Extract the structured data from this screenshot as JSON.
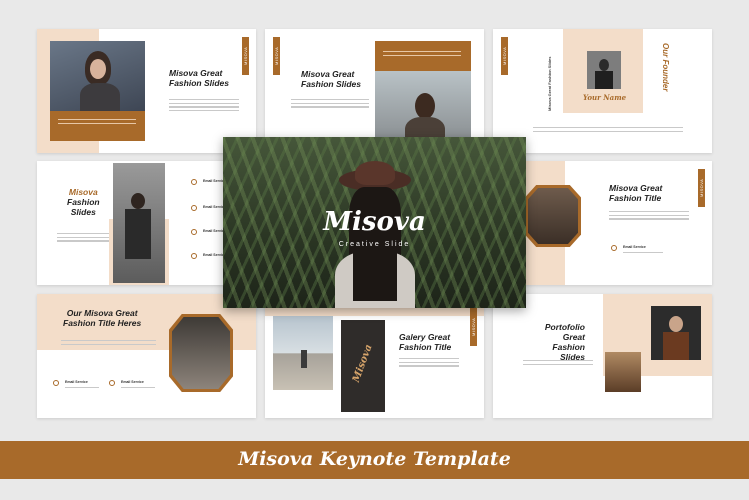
{
  "hero": {
    "logo": "Misova",
    "subtitle": "Creative Slide"
  },
  "slides": {
    "s1": {
      "title_1": "Misova Great",
      "title_2": "Fashion Slides",
      "tab": "MISOVA"
    },
    "s2": {
      "title_1": "Misova Great",
      "title_2": "Fashion Slides",
      "tab": "MISOVA"
    },
    "s3": {
      "side_text": "Misova Great Fashion Slides",
      "name": "Your Name",
      "founder": "Our Founder",
      "tab": "MISOVA"
    },
    "s4": {
      "title_1": "Misova",
      "title_2": "Fashion",
      "title_3": "Slides",
      "items": [
        "Email Service",
        "Email Service",
        "Email Service",
        "Email Service"
      ]
    },
    "s6": {
      "title_1": "Misova Great",
      "title_2": "Fashion Title",
      "item": "Email Service",
      "tab": "MISOVA"
    },
    "s7": {
      "title_1": "Our Misova Great",
      "title_2": "Fashion Title Heres",
      "item_1": "Email Service",
      "item_2": "Email Service"
    },
    "s8": {
      "title_1": "Galery Great",
      "title_2": "Fashion Title",
      "logo": "Misova",
      "tab": "MISOVA"
    },
    "s9": {
      "title_1": "Portofolio",
      "title_2": "Great",
      "title_3": "Fashion Slides"
    }
  },
  "banner": {
    "text": "Misova Keynote Template",
    "color": "#a86a2a"
  },
  "colors": {
    "accent": "#a86a2a",
    "beige": "#f3ddc9"
  }
}
